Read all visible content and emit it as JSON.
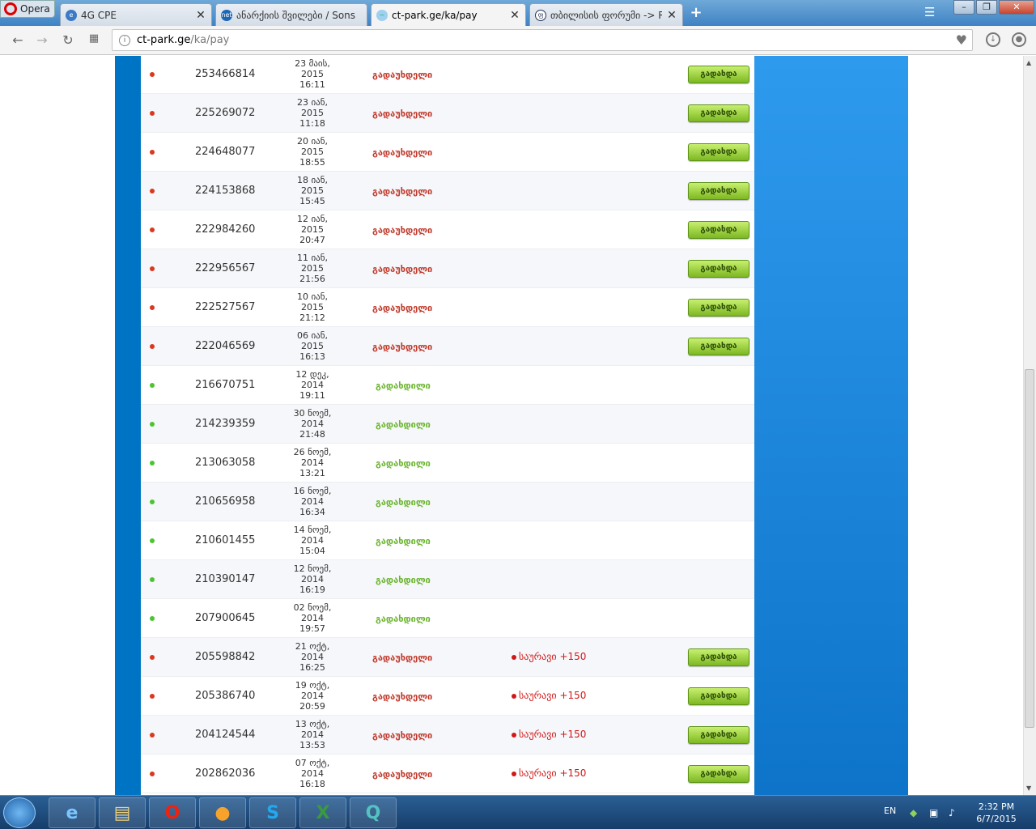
{
  "browser": {
    "opera_label": "Opera",
    "tabs": [
      {
        "title": "4G CPE",
        "active": false
      },
      {
        "title": "ანარქიის შვილები / Sons",
        "active": false
      },
      {
        "title": "ct-park.ge/ka/pay",
        "active": true
      },
      {
        "title": "თბილისის ფორუმი -> Re",
        "active": false
      }
    ],
    "new_tab": "+",
    "url_host": "ct-park.ge",
    "url_path": "/ka/pay"
  },
  "payments": {
    "pay_button_label": "გადახდა",
    "rows": [
      {
        "id": "253466814",
        "date": [
          "23 მაის,",
          "2015",
          "16:11"
        ],
        "status": "გადაუხდელი",
        "status_type": "unpaid",
        "penalty": "",
        "has_button": true
      },
      {
        "id": "225269072",
        "date": [
          "23 იან,",
          "2015",
          "11:18"
        ],
        "status": "გადაუხდელი",
        "status_type": "unpaid",
        "penalty": "",
        "has_button": true
      },
      {
        "id": "224648077",
        "date": [
          "20 იან,",
          "2015",
          "18:55"
        ],
        "status": "გადაუხდელი",
        "status_type": "unpaid",
        "penalty": "",
        "has_button": true
      },
      {
        "id": "224153868",
        "date": [
          "18 იან,",
          "2015",
          "15:45"
        ],
        "status": "გადაუხდელი",
        "status_type": "unpaid",
        "penalty": "",
        "has_button": true
      },
      {
        "id": "222984260",
        "date": [
          "12 იან,",
          "2015",
          "20:47"
        ],
        "status": "გადაუხდელი",
        "status_type": "unpaid",
        "penalty": "",
        "has_button": true
      },
      {
        "id": "222956567",
        "date": [
          "11 იან,",
          "2015",
          "21:56"
        ],
        "status": "გადაუხდელი",
        "status_type": "unpaid",
        "penalty": "",
        "has_button": true
      },
      {
        "id": "222527567",
        "date": [
          "10 იან,",
          "2015",
          "21:12"
        ],
        "status": "გადაუხდელი",
        "status_type": "unpaid",
        "penalty": "",
        "has_button": true
      },
      {
        "id": "222046569",
        "date": [
          "06 იან,",
          "2015",
          "16:13"
        ],
        "status": "გადაუხდელი",
        "status_type": "unpaid",
        "penalty": "",
        "has_button": true
      },
      {
        "id": "216670751",
        "date": [
          "12 დეკ,",
          "2014",
          "19:11"
        ],
        "status": "გადახდილი",
        "status_type": "paid",
        "penalty": "",
        "has_button": false
      },
      {
        "id": "214239359",
        "date": [
          "30 ნოემ,",
          "2014",
          "21:48"
        ],
        "status": "გადახდილი",
        "status_type": "paid",
        "penalty": "",
        "has_button": false
      },
      {
        "id": "213063058",
        "date": [
          "26 ნოემ,",
          "2014",
          "13:21"
        ],
        "status": "გადახდილი",
        "status_type": "paid",
        "penalty": "",
        "has_button": false
      },
      {
        "id": "210656958",
        "date": [
          "16 ნოემ,",
          "2014",
          "16:34"
        ],
        "status": "გადახდილი",
        "status_type": "paid",
        "penalty": "",
        "has_button": false
      },
      {
        "id": "210601455",
        "date": [
          "14 ნოემ,",
          "2014",
          "15:04"
        ],
        "status": "გადახდილი",
        "status_type": "paid",
        "penalty": "",
        "has_button": false
      },
      {
        "id": "210390147",
        "date": [
          "12 ნოემ,",
          "2014",
          "16:19"
        ],
        "status": "გადახდილი",
        "status_type": "paid",
        "penalty": "",
        "has_button": false
      },
      {
        "id": "207900645",
        "date": [
          "02 ნოემ,",
          "2014",
          "19:57"
        ],
        "status": "გადახდილი",
        "status_type": "paid",
        "penalty": "",
        "has_button": false
      },
      {
        "id": "205598842",
        "date": [
          "21 ოქტ,",
          "2014",
          "16:25"
        ],
        "status": "გადაუხდელი",
        "status_type": "unpaid",
        "penalty": "საურავი +150",
        "has_button": true
      },
      {
        "id": "205386740",
        "date": [
          "19 ოქტ,",
          "2014",
          "20:59"
        ],
        "status": "გადაუხდელი",
        "status_type": "unpaid",
        "penalty": "საურავი +150",
        "has_button": true
      },
      {
        "id": "204124544",
        "date": [
          "13 ოქტ,",
          "2014",
          "13:53"
        ],
        "status": "გადაუხდელი",
        "status_type": "unpaid",
        "penalty": "საურავი +150",
        "has_button": true
      },
      {
        "id": "202862036",
        "date": [
          "07 ოქტ,",
          "2014",
          "16:18"
        ],
        "status": "გადაუხდელი",
        "status_type": "unpaid",
        "penalty": "საურავი +150",
        "has_button": true
      }
    ]
  },
  "colors": {
    "unpaid": "#c0392b",
    "paid": "#6ab42d",
    "unpaid_dot": "#d9381e",
    "paid_dot": "#4cc430"
  },
  "taskbar": {
    "language": "EN",
    "time": "2:32 PM",
    "date": "6/7/2015",
    "apps": [
      "internet-explorer",
      "file-explorer",
      "opera",
      "chrome-like",
      "skype",
      "excel",
      "app-q"
    ]
  }
}
